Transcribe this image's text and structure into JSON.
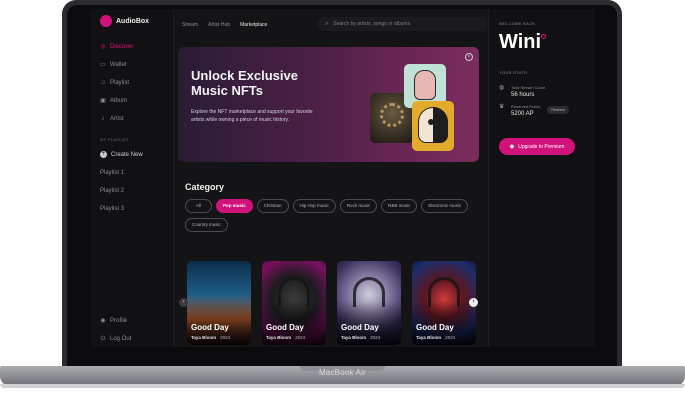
{
  "device": {
    "label": "MacBook Air"
  },
  "app": {
    "name": "AudioBox",
    "brand_color": "#d2127b"
  },
  "sidebar": {
    "items": [
      {
        "label": "Discover",
        "icon": "discover-icon",
        "active": true
      },
      {
        "label": "Wallet",
        "icon": "wallet-icon"
      },
      {
        "label": "Playlist",
        "icon": "music-note-icon"
      },
      {
        "label": "Album",
        "icon": "album-icon"
      },
      {
        "label": "Artist",
        "icon": "artist-icon"
      }
    ],
    "section_label": "MY PLAYLIST",
    "create_label": "Create New",
    "playlists": [
      "Playlist 1",
      "Playlist 2",
      "Playlist 3"
    ],
    "bottom": [
      {
        "label": "Profile",
        "icon": "profile-icon"
      },
      {
        "label": "Log Out",
        "icon": "logout-icon"
      }
    ]
  },
  "topbar": {
    "tabs": [
      {
        "label": "Stream"
      },
      {
        "label": "Artist Hub"
      },
      {
        "label": "Marketplace",
        "active": true
      }
    ],
    "search_placeholder": "Search by artists, songs or albums"
  },
  "banner": {
    "title": "Unlock Exclusive Music NFTs",
    "text": "Explore the NFT marketplace and support your favorite artists while owning a piece of music history."
  },
  "category": {
    "title": "Category",
    "chips": [
      "All",
      "Pop music",
      "Christian",
      "Hip Hop music",
      "Rock music",
      "R&B music",
      "Electronic music",
      "Country music"
    ],
    "active": "Pop music"
  },
  "cards": [
    {
      "title": "Good Day",
      "artist": "Taya Bloom",
      "year": "2024"
    },
    {
      "title": "Good Day",
      "artist": "Taya Bloom",
      "year": "2024"
    },
    {
      "title": "Good Day",
      "artist": "Taya Bloom",
      "year": "2024"
    },
    {
      "title": "Good Day",
      "artist": "Taya Bloom",
      "year": "2024"
    }
  ],
  "right_panel": {
    "welcome": "WELCOME BACK",
    "user": "Wini",
    "stats_label": "YOUR STATS",
    "stats": [
      {
        "name": "Total Stream Count",
        "value": "56 hours",
        "icon": "stream-icon"
      },
      {
        "name": "Reserved Points",
        "value": "5200 AP",
        "icon": "trophy-icon"
      }
    ],
    "redeem_label": "Redeem",
    "premium_label": "Upgrade to Premium"
  }
}
